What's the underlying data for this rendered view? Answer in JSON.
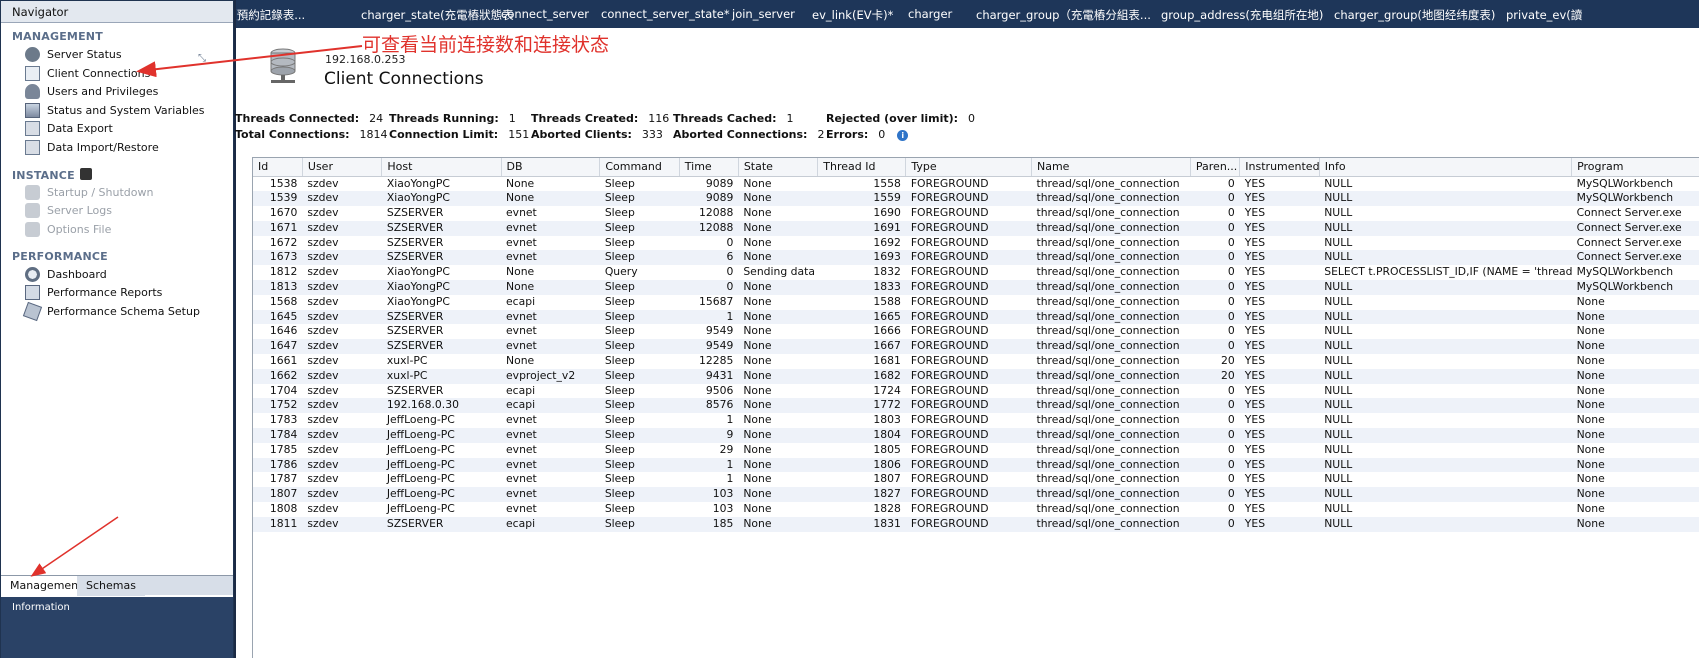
{
  "navigator": {
    "title": "Navigator",
    "sections": {
      "management": "MANAGEMENT",
      "instance": "INSTANCE",
      "performance": "PERFORMANCE"
    },
    "management_items": [
      {
        "label": "Server Status",
        "icon": "server-status-icon"
      },
      {
        "label": "Client Connections",
        "icon": "client-connections-icon"
      },
      {
        "label": "Users and Privileges",
        "icon": "users-icon"
      },
      {
        "label": "Status and System Variables",
        "icon": "variables-icon"
      },
      {
        "label": "Data Export",
        "icon": "data-export-icon"
      },
      {
        "label": "Data Import/Restore",
        "icon": "data-import-icon"
      }
    ],
    "instance_items": [
      {
        "label": "Startup / Shutdown",
        "icon": "startup-icon"
      },
      {
        "label": "Server Logs",
        "icon": "server-logs-icon"
      },
      {
        "label": "Options File",
        "icon": "options-file-icon"
      }
    ],
    "performance_items": [
      {
        "label": "Dashboard",
        "icon": "dashboard-icon"
      },
      {
        "label": "Performance Reports",
        "icon": "performance-reports-icon"
      },
      {
        "label": "Performance Schema Setup",
        "icon": "schema-setup-icon"
      }
    ],
    "tabs": {
      "management": "Management",
      "schemas": "Schemas"
    },
    "info_label": "Information"
  },
  "top_tabs": [
    "l（預約記錄表...",
    "charger_state(充電樁狀態表",
    "connect_server",
    "connect_server_state*",
    "join_server",
    "ev_link(EV卡)*",
    "charger",
    "charger_group（充電樁分組表...",
    "group_address(充电组所在地)",
    "charger_group(地图经纬度表)",
    "private_ev(讀"
  ],
  "header": {
    "server_ip": "192.168.0.253",
    "title": "Client Connections"
  },
  "stats": {
    "threads_connected": {
      "label": "Threads Connected:",
      "value": "24"
    },
    "threads_running": {
      "label": "Threads Running:",
      "value": "1"
    },
    "threads_created": {
      "label": "Threads Created:",
      "value": "116"
    },
    "threads_cached": {
      "label": "Threads Cached:",
      "value": "1"
    },
    "rejected": {
      "label": "Rejected (over limit):",
      "value": "0"
    },
    "total_connections": {
      "label": "Total Connections:",
      "value": "1814"
    },
    "connection_limit": {
      "label": "Connection Limit:",
      "value": "151"
    },
    "aborted_clients": {
      "label": "Aborted Clients:",
      "value": "333"
    },
    "aborted_connections": {
      "label": "Aborted Connections:",
      "value": "2"
    },
    "errors": {
      "label": "Errors:",
      "value": "0"
    }
  },
  "table": {
    "columns": [
      "Id",
      "User",
      "Host",
      "DB",
      "Command",
      "Time",
      "State",
      "Thread Id",
      "Type",
      "Name",
      "Paren...",
      "Instrumented",
      "Info",
      "Program"
    ],
    "rows": [
      [
        "1538",
        "szdev",
        "XiaoYongPC",
        "None",
        "Sleep",
        "9089",
        "None",
        "1558",
        "FOREGROUND",
        "thread/sql/one_connection",
        "0",
        "YES",
        "NULL",
        "MySQLWorkbench"
      ],
      [
        "1539",
        "szdev",
        "XiaoYongPC",
        "None",
        "Sleep",
        "9089",
        "None",
        "1559",
        "FOREGROUND",
        "thread/sql/one_connection",
        "0",
        "YES",
        "NULL",
        "MySQLWorkbench"
      ],
      [
        "1670",
        "szdev",
        "SZSERVER",
        "evnet",
        "Sleep",
        "12088",
        "None",
        "1690",
        "FOREGROUND",
        "thread/sql/one_connection",
        "0",
        "YES",
        "NULL",
        "Connect Server.exe"
      ],
      [
        "1671",
        "szdev",
        "SZSERVER",
        "evnet",
        "Sleep",
        "12088",
        "None",
        "1691",
        "FOREGROUND",
        "thread/sql/one_connection",
        "0",
        "YES",
        "NULL",
        "Connect Server.exe"
      ],
      [
        "1672",
        "szdev",
        "SZSERVER",
        "evnet",
        "Sleep",
        "0",
        "None",
        "1692",
        "FOREGROUND",
        "thread/sql/one_connection",
        "0",
        "YES",
        "NULL",
        "Connect Server.exe"
      ],
      [
        "1673",
        "szdev",
        "SZSERVER",
        "evnet",
        "Sleep",
        "6",
        "None",
        "1693",
        "FOREGROUND",
        "thread/sql/one_connection",
        "0",
        "YES",
        "NULL",
        "Connect Server.exe"
      ],
      [
        "1812",
        "szdev",
        "XiaoYongPC",
        "None",
        "Query",
        "0",
        "Sending data",
        "1832",
        "FOREGROUND",
        "thread/sql/one_connection",
        "0",
        "YES",
        "SELECT t.PROCESSLIST_ID,IF (NAME = 'thread...",
        "MySQLWorkbench"
      ],
      [
        "1813",
        "szdev",
        "XiaoYongPC",
        "None",
        "Sleep",
        "0",
        "None",
        "1833",
        "FOREGROUND",
        "thread/sql/one_connection",
        "0",
        "YES",
        "NULL",
        "MySQLWorkbench"
      ],
      [
        "1568",
        "szdev",
        "XiaoYongPC",
        "ecapi",
        "Sleep",
        "15687",
        "None",
        "1588",
        "FOREGROUND",
        "thread/sql/one_connection",
        "0",
        "YES",
        "NULL",
        "None"
      ],
      [
        "1645",
        "szdev",
        "SZSERVER",
        "evnet",
        "Sleep",
        "1",
        "None",
        "1665",
        "FOREGROUND",
        "thread/sql/one_connection",
        "0",
        "YES",
        "NULL",
        "None"
      ],
      [
        "1646",
        "szdev",
        "SZSERVER",
        "evnet",
        "Sleep",
        "9549",
        "None",
        "1666",
        "FOREGROUND",
        "thread/sql/one_connection",
        "0",
        "YES",
        "NULL",
        "None"
      ],
      [
        "1647",
        "szdev",
        "SZSERVER",
        "evnet",
        "Sleep",
        "9549",
        "None",
        "1667",
        "FOREGROUND",
        "thread/sql/one_connection",
        "0",
        "YES",
        "NULL",
        "None"
      ],
      [
        "1661",
        "szdev",
        "xuxl-PC",
        "None",
        "Sleep",
        "12285",
        "None",
        "1681",
        "FOREGROUND",
        "thread/sql/one_connection",
        "20",
        "YES",
        "NULL",
        "None"
      ],
      [
        "1662",
        "szdev",
        "xuxl-PC",
        "evproject_v2",
        "Sleep",
        "9431",
        "None",
        "1682",
        "FOREGROUND",
        "thread/sql/one_connection",
        "20",
        "YES",
        "NULL",
        "None"
      ],
      [
        "1704",
        "szdev",
        "SZSERVER",
        "ecapi",
        "Sleep",
        "9506",
        "None",
        "1724",
        "FOREGROUND",
        "thread/sql/one_connection",
        "0",
        "YES",
        "NULL",
        "None"
      ],
      [
        "1752",
        "szdev",
        "192.168.0.30",
        "ecapi",
        "Sleep",
        "8576",
        "None",
        "1772",
        "FOREGROUND",
        "thread/sql/one_connection",
        "0",
        "YES",
        "NULL",
        "None"
      ],
      [
        "1783",
        "szdev",
        "JeffLoeng-PC",
        "evnet",
        "Sleep",
        "1",
        "None",
        "1803",
        "FOREGROUND",
        "thread/sql/one_connection",
        "0",
        "YES",
        "NULL",
        "None"
      ],
      [
        "1784",
        "szdev",
        "JeffLoeng-PC",
        "evnet",
        "Sleep",
        "9",
        "None",
        "1804",
        "FOREGROUND",
        "thread/sql/one_connection",
        "0",
        "YES",
        "NULL",
        "None"
      ],
      [
        "1785",
        "szdev",
        "JeffLoeng-PC",
        "evnet",
        "Sleep",
        "29",
        "None",
        "1805",
        "FOREGROUND",
        "thread/sql/one_connection",
        "0",
        "YES",
        "NULL",
        "None"
      ],
      [
        "1786",
        "szdev",
        "JeffLoeng-PC",
        "evnet",
        "Sleep",
        "1",
        "None",
        "1806",
        "FOREGROUND",
        "thread/sql/one_connection",
        "0",
        "YES",
        "NULL",
        "None"
      ],
      [
        "1787",
        "szdev",
        "JeffLoeng-PC",
        "evnet",
        "Sleep",
        "1",
        "None",
        "1807",
        "FOREGROUND",
        "thread/sql/one_connection",
        "0",
        "YES",
        "NULL",
        "None"
      ],
      [
        "1807",
        "szdev",
        "JeffLoeng-PC",
        "evnet",
        "Sleep",
        "103",
        "None",
        "1827",
        "FOREGROUND",
        "thread/sql/one_connection",
        "0",
        "YES",
        "NULL",
        "None"
      ],
      [
        "1808",
        "szdev",
        "JeffLoeng-PC",
        "evnet",
        "Sleep",
        "103",
        "None",
        "1828",
        "FOREGROUND",
        "thread/sql/one_connection",
        "0",
        "YES",
        "NULL",
        "None"
      ],
      [
        "1811",
        "szdev",
        "SZSERVER",
        "ecapi",
        "Sleep",
        "185",
        "None",
        "1831",
        "FOREGROUND",
        "thread/sql/one_connection",
        "0",
        "YES",
        "NULL",
        "None"
      ]
    ]
  },
  "annotation": {
    "text": "可查看当前连接数和连接状态",
    "color": "#e0322c"
  },
  "colors": {
    "tabbar_bg": "#1e3659",
    "navigator_bg": "#1f3350",
    "row_alt": "#eef2f9"
  }
}
